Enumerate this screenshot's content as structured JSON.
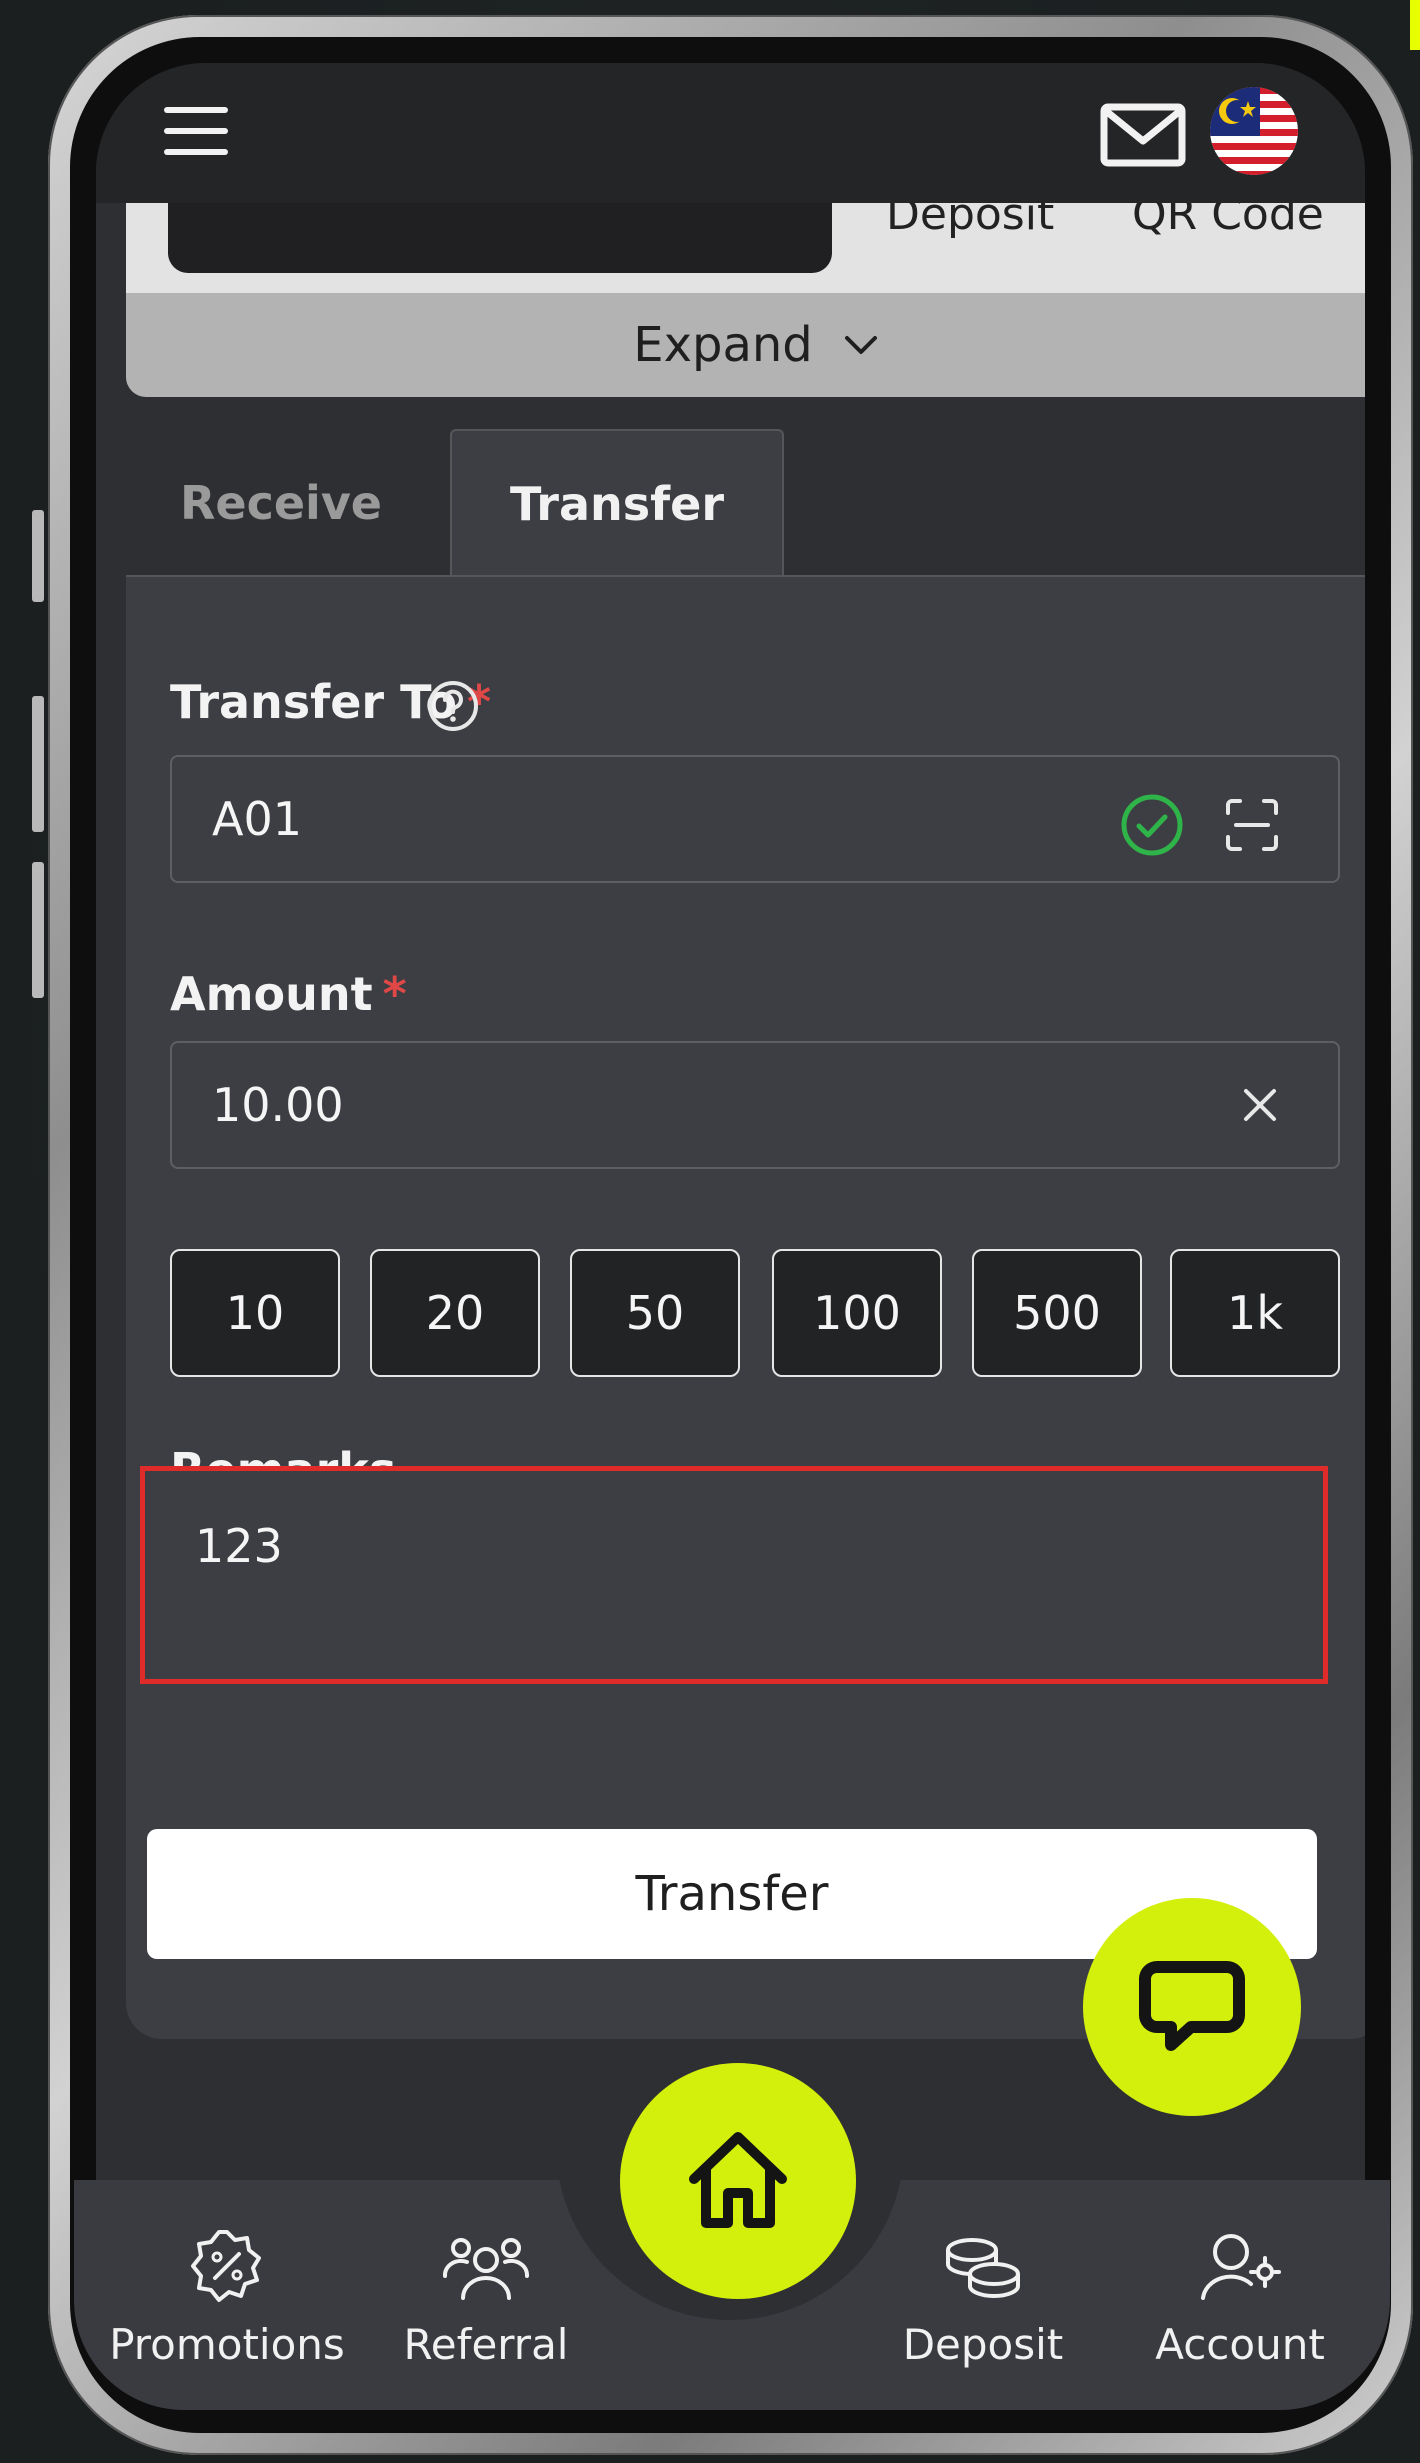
{
  "header": {
    "menu_icon": "hamburger-menu-icon",
    "mail_icon": "envelope-icon",
    "flag_icon": "malaysia-flag-icon"
  },
  "top_card": {
    "cut_text_left": "Deposit",
    "cut_text_right": "QR Code",
    "expand_label": "Expand"
  },
  "tabs": [
    {
      "label": "Receive",
      "active": false
    },
    {
      "label": "Transfer",
      "active": true
    }
  ],
  "form": {
    "transfer_to_label": "Transfer To",
    "required_mark": "*",
    "transfer_to_value": "A01",
    "amount_label": "Amount",
    "amount_value": "10.00",
    "quick_amounts": [
      "10",
      "20",
      "50",
      "100",
      "500",
      "1k"
    ],
    "remarks_label": "Remarks",
    "remarks_value": "123",
    "submit_label": "Transfer"
  },
  "bottom_nav": [
    {
      "label": "Promotions",
      "icon": "discount-badge-icon"
    },
    {
      "label": "Referral",
      "icon": "users-group-icon"
    },
    {
      "label": "Deposit",
      "icon": "coins-stack-icon"
    },
    {
      "label": "Account",
      "icon": "user-settings-icon"
    }
  ],
  "colors": {
    "accent": "#d3ef0c",
    "panel": "#3d3e43",
    "required": "#e04848",
    "highlight": "#e02b2b",
    "valid": "#2fb44a"
  }
}
